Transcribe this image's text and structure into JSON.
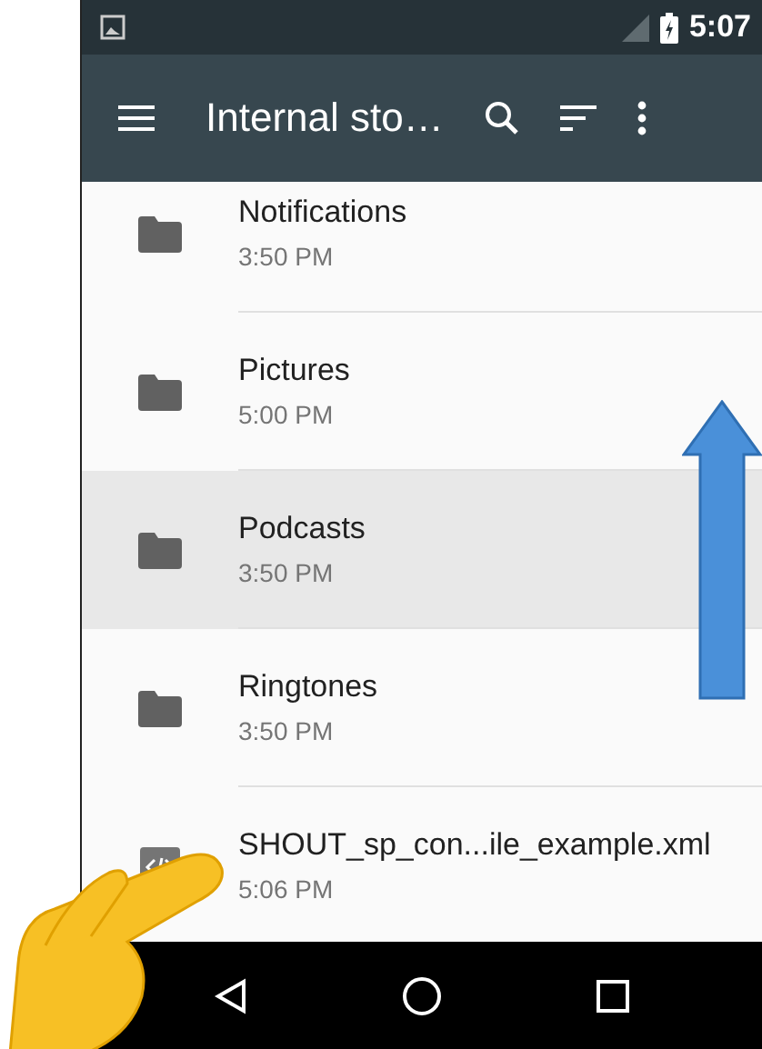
{
  "status_bar": {
    "time": "5:07"
  },
  "toolbar": {
    "title": "Internal sto…"
  },
  "files": [
    {
      "kind": "folder",
      "name": "Notifications",
      "time": "3:50 PM",
      "selected": false
    },
    {
      "kind": "folder",
      "name": "Pictures",
      "time": "5:00 PM",
      "selected": false
    },
    {
      "kind": "folder",
      "name": "Podcasts",
      "time": "3:50 PM",
      "selected": true
    },
    {
      "kind": "folder",
      "name": "Ringtones",
      "time": "3:50 PM",
      "selected": false
    },
    {
      "kind": "file",
      "name": "SHOUT_sp_con...ile_example.xml",
      "time": "5:06 PM",
      "selected": false
    }
  ]
}
